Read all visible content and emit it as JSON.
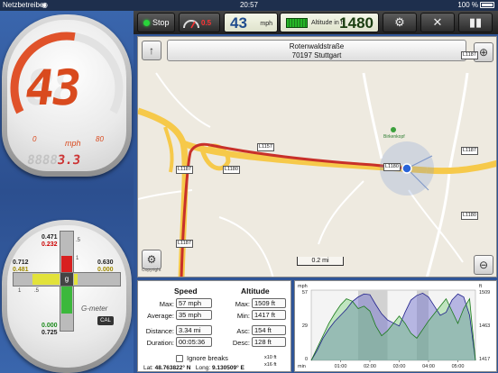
{
  "status": {
    "carrier": "Netzbetreiber",
    "time": "20:57",
    "battery": "100 %"
  },
  "toolbar": {
    "stop_label": "Stop",
    "gauge_label": "0.5",
    "speed_value": "43",
    "speed_unit": "mph",
    "altitude_label": "Altitude in ft",
    "altitude_value": "1480"
  },
  "speedometer": {
    "speed": "43",
    "ghost": "88",
    "unit": "mph",
    "scale_min": "0",
    "scale_max": "80",
    "odo_ghost": "8888",
    "odo_value": "3.3",
    "fraction": 0.5375
  },
  "gmeter": {
    "top_white": "0.471",
    "top_red": "0.232",
    "left_white": "0.712",
    "left_yellow": "0.481",
    "right_white": "0.630",
    "right_yellow": "0.000",
    "bottom_green": "0.000",
    "bottom_white": "0.725",
    "tick_top": ".5",
    "tick_1": "1",
    "tick_half": ".5",
    "tick_1b": "1",
    "center": "g",
    "label": "G-meter",
    "cal": "CAL"
  },
  "map": {
    "street": "Rotenwaldstraße",
    "city": "70197 Stuttgart",
    "scale": "0.2 mi",
    "copyright": "Copyright",
    "poi": "Birkenkopf",
    "roads": [
      "L1157",
      "L1187",
      "L1180",
      "L1187",
      "L1187",
      "L1180",
      "L1187",
      "L1180"
    ]
  },
  "stats": {
    "speed_header": "Speed",
    "altitude_header": "Altitude",
    "max_label": "Max:",
    "max_speed": "57 mph",
    "avg_label": "Average:",
    "avg_speed": "35 mph",
    "dist_label": "Distance:",
    "distance": "3.34 mi",
    "dur_label": "Duration:",
    "duration": "00:05:36",
    "amax_label": "Max:",
    "alt_max": "1509 ft",
    "amin_label": "Min:",
    "alt_min": "1417 ft",
    "asc_label": "Asc:",
    "ascent": "154 ft",
    "desc_label": "Desc:",
    "descent": "128 ft",
    "ignore_breaks": "Ignore breaks",
    "lat_label": "Lat:",
    "lat": "48.763822° N",
    "long_label": "Long:",
    "long": "9.130509° E",
    "x10": "x10 ft",
    "x16": "x16 ft"
  },
  "chart_data": {
    "type": "area",
    "x_tick_labels": [
      "01:00",
      "02:00",
      "03:00",
      "04:00",
      "05:00"
    ],
    "x_unit_label": "min",
    "left_axis_label": "mph",
    "left_ticks": [
      "57",
      "29",
      "0"
    ],
    "right_axis_label": "ft",
    "right_ticks": [
      "1509",
      "1463",
      "1417"
    ],
    "xlim": [
      0,
      5.6
    ],
    "speed_ylim": [
      0,
      57
    ],
    "altitude_ylim": [
      1417,
      1509
    ],
    "series": [
      {
        "values_key": "altitude",
        "color": "#6a6acb"
      },
      {
        "values_key": "speed",
        "color": "#5fc85f"
      }
    ],
    "x": [
      0,
      0.2,
      0.4,
      0.6,
      0.8,
      1.0,
      1.2,
      1.4,
      1.6,
      1.8,
      2.0,
      2.2,
      2.4,
      2.6,
      2.8,
      3.0,
      3.2,
      3.4,
      3.6,
      3.8,
      4.0,
      4.2,
      4.4,
      4.6,
      4.8,
      5.0,
      5.2,
      5.4,
      5.6
    ],
    "speed": [
      0,
      10,
      20,
      30,
      38,
      45,
      50,
      48,
      42,
      44,
      40,
      28,
      20,
      24,
      30,
      36,
      30,
      22,
      18,
      25,
      32,
      38,
      44,
      50,
      40,
      30,
      42,
      50,
      0
    ],
    "altitude": [
      1417,
      1430,
      1446,
      1458,
      1468,
      1476,
      1484,
      1494,
      1500,
      1504,
      1503,
      1490,
      1478,
      1470,
      1466,
      1462,
      1480,
      1496,
      1502,
      1505,
      1500,
      1488,
      1476,
      1480,
      1496,
      1504,
      1500,
      1476,
      1417
    ],
    "shaded_bands": [
      [
        1.6,
        2.6
      ],
      [
        3.6,
        4.0
      ]
    ]
  }
}
